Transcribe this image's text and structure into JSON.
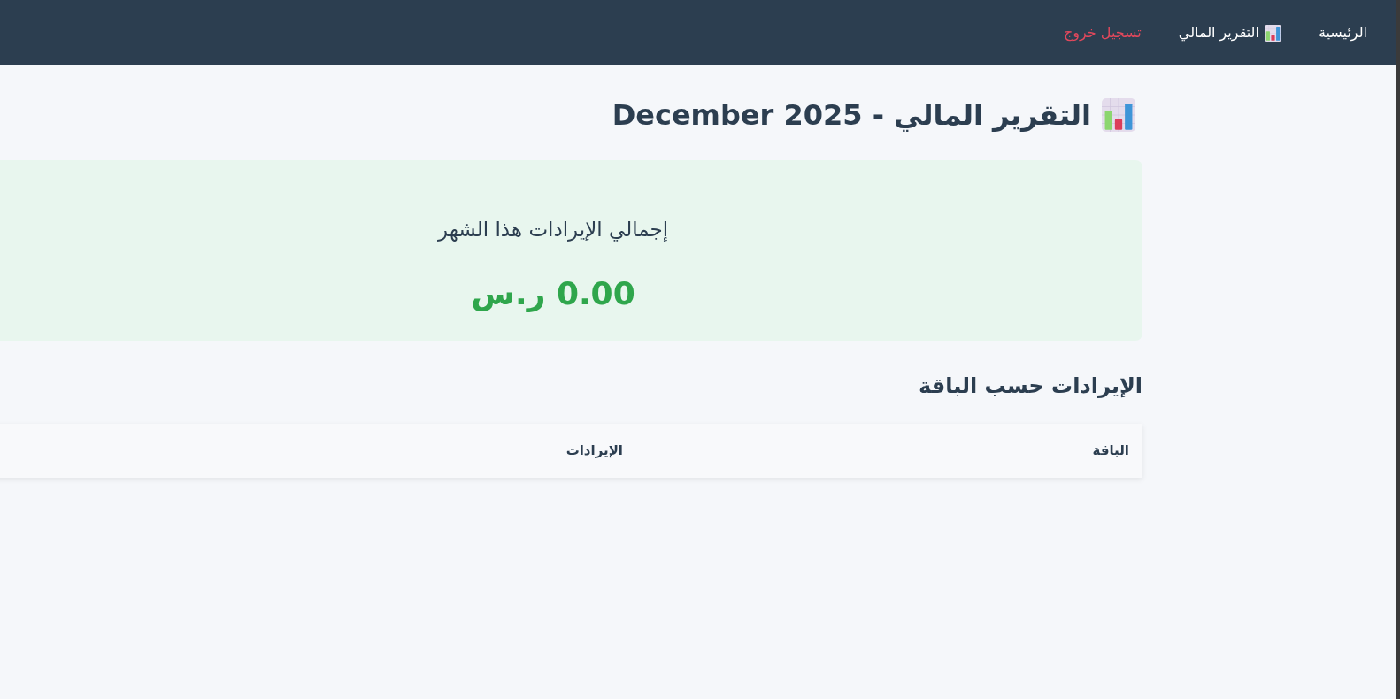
{
  "navbar": {
    "links": [
      {
        "label": "الرئيسية",
        "kind": "plain"
      },
      {
        "label": "التقرير المالي",
        "kind": "chart"
      },
      {
        "label": "تسجيل خروج",
        "kind": "logout"
      }
    ]
  },
  "page_title": "التقرير المالي - December 2025",
  "summary_card": {
    "label": "إجمالي الإيرادات هذا الشهر",
    "value": "0.00 ر.س"
  },
  "section_title": "الإيرادات حسب الباقة",
  "table": {
    "columns": [
      "الباقة",
      "الإيرادات"
    ]
  }
}
